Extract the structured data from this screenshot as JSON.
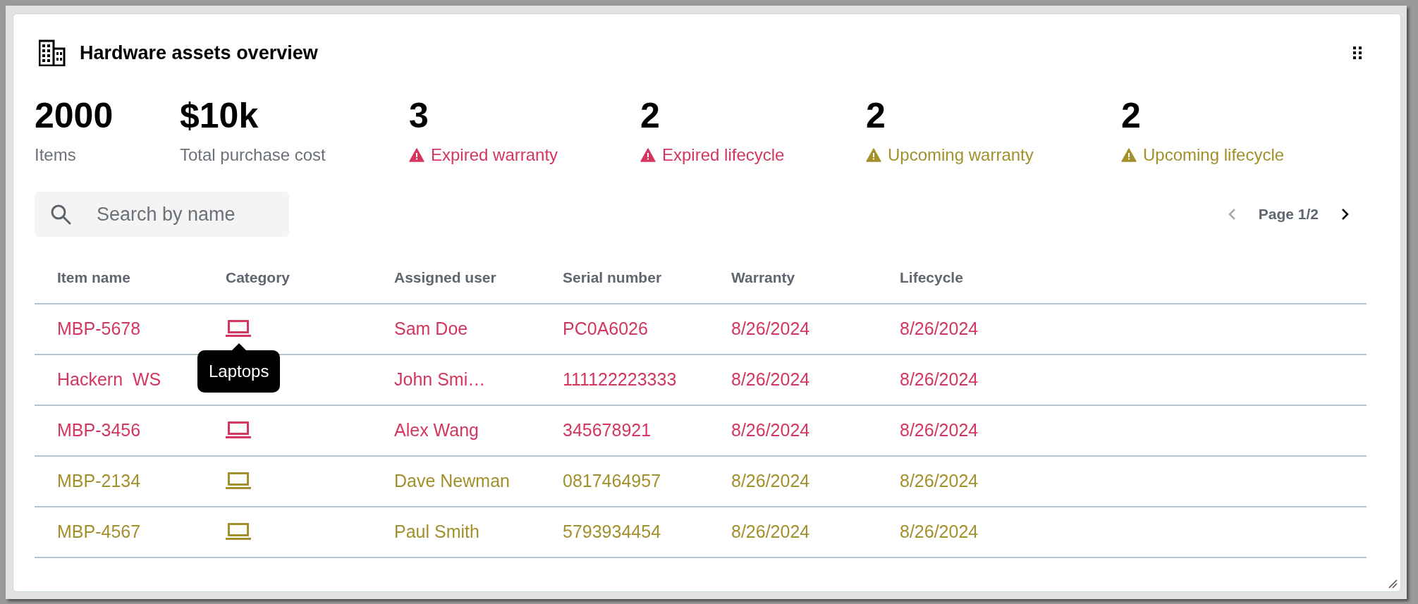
{
  "card": {
    "title": "Hardware assets overview"
  },
  "stats": [
    {
      "value": "2000",
      "label": "Items",
      "kind": "plain"
    },
    {
      "value": "$10k",
      "label": "Total purchase cost",
      "kind": "plain"
    },
    {
      "value": "3",
      "label": "Expired warranty",
      "kind": "expired"
    },
    {
      "value": "2",
      "label": "Expired lifecycle",
      "kind": "expired"
    },
    {
      "value": "2",
      "label": "Upcoming warranty",
      "kind": "upcoming"
    },
    {
      "value": "2",
      "label": "Upcoming lifecycle",
      "kind": "upcoming"
    }
  ],
  "search": {
    "placeholder": "Search by name"
  },
  "pagination": {
    "label": "Page 1/2",
    "prev_disabled": true,
    "next_disabled": false
  },
  "table": {
    "columns": [
      "Item name",
      "Category",
      "Assigned user",
      "Serial number",
      "Warranty",
      "Lifecycle"
    ],
    "rows": [
      {
        "kind": "expired",
        "item_name": "MBP-5678",
        "category_icon_visible": true,
        "tooltip": "Laptops",
        "assigned_user": "Sam Doe",
        "serial_number": "PC0A6026",
        "warranty": "8/26/2024",
        "lifecycle": "8/26/2024"
      },
      {
        "kind": "expired",
        "item_name": "Hackern  WS",
        "category_icon_visible": false,
        "assigned_user": "John Smi…",
        "serial_number": "111122223333",
        "warranty": "8/26/2024",
        "lifecycle": "8/26/2024"
      },
      {
        "kind": "expired",
        "item_name": "MBP-3456",
        "category_icon_visible": true,
        "assigned_user": "Alex Wang",
        "serial_number": "345678921",
        "warranty": "8/26/2024",
        "lifecycle": "8/26/2024"
      },
      {
        "kind": "upcoming",
        "item_name": "MBP-2134",
        "category_icon_visible": true,
        "assigned_user": "Dave Newman",
        "serial_number": "0817464957",
        "warranty": "8/26/2024",
        "lifecycle": "8/26/2024"
      },
      {
        "kind": "upcoming",
        "item_name": "MBP-4567",
        "category_icon_visible": true,
        "assigned_user": "Paul Smith",
        "serial_number": "5793934454",
        "warranty": "8/26/2024",
        "lifecycle": "8/26/2024"
      }
    ]
  }
}
